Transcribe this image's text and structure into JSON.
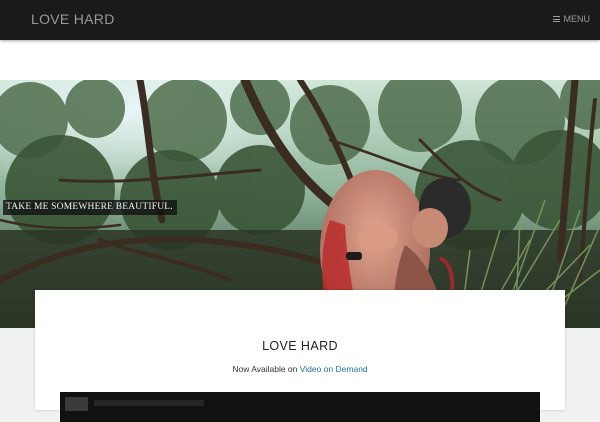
{
  "header": {
    "site_title": "LOVE HARD",
    "menu_label": "MENU",
    "menu_icon": "hamburger-icon"
  },
  "hero": {
    "caption": "TAKE ME SOMEWHERE BEAUTIFUL."
  },
  "entry": {
    "title": "LOVE HARD",
    "sub_text": "Now Available on ",
    "sub_link": "Video on Demand"
  },
  "colors": {
    "topbar_bg": "#1a1a1a",
    "title_gray": "#9a9a9a",
    "link_blue": "#21759b",
    "page_bg": "#f1f1f1"
  }
}
